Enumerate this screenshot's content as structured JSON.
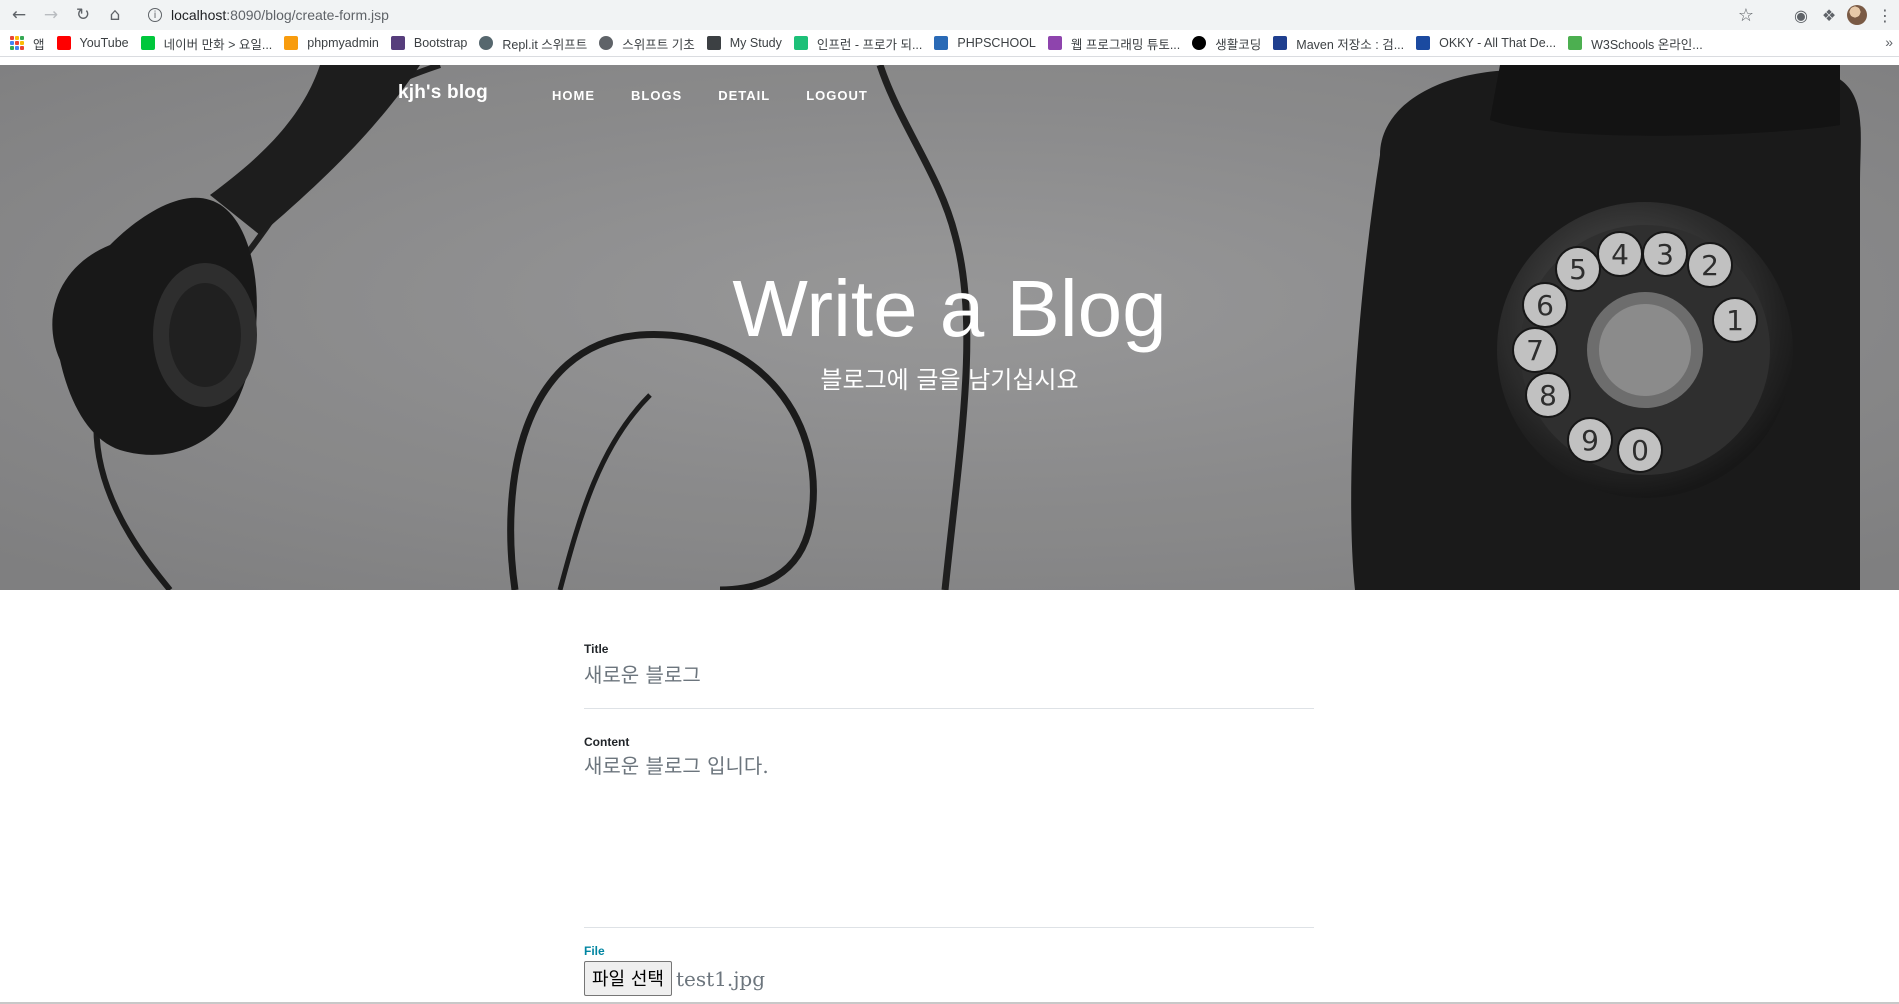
{
  "browser": {
    "url_host": "localhost",
    "url_path": ":8090/blog/create-form.jsp",
    "bookmarks": [
      {
        "label": "앱",
        "icon": "apps-grid-icon"
      },
      {
        "label": "YouTube",
        "icon": "youtube-icon",
        "color": "#ff0000"
      },
      {
        "label": "네이버 만화 > 요일...",
        "icon": "naver-webtoon-icon",
        "color": "#00c73c"
      },
      {
        "label": "phpmyadmin",
        "icon": "phpmyadmin-icon",
        "color": "#f89c0e"
      },
      {
        "label": "Bootstrap",
        "icon": "bootstrap-icon",
        "color": "#563d7c"
      },
      {
        "label": "Repl.it 스위프트",
        "icon": "replit-icon",
        "color": "#56676e"
      },
      {
        "label": "스위프트 기초",
        "icon": "globe-icon",
        "color": "#5f6368"
      },
      {
        "label": "My Study",
        "icon": "mystudy-icon",
        "color": "#3c4043"
      },
      {
        "label": "인프런 - 프로가 되...",
        "icon": "inflearn-icon",
        "color": "#1dc078"
      },
      {
        "label": "PHPSCHOOL",
        "icon": "phpschool-icon",
        "color": "#2a6ab6"
      },
      {
        "label": "웹 프로그래밍 튜토...",
        "icon": "webprog-icon",
        "color": "#8e44ad"
      },
      {
        "label": "생활코딩",
        "icon": "opentutorials-icon",
        "color": "#000000"
      },
      {
        "label": "Maven 저장소 : 검...",
        "icon": "maven-icon",
        "color": "#1f3f8f"
      },
      {
        "label": "OKKY - All That De...",
        "icon": "okky-icon",
        "color": "#1b4aa0"
      },
      {
        "label": "W3Schools 온라인...",
        "icon": "w3schools-icon",
        "color": "#4caf50"
      }
    ]
  },
  "nav": {
    "brand": "kjh's blog",
    "links": [
      "HOME",
      "BLOGS",
      "DETAIL",
      "LOGOUT"
    ]
  },
  "hero": {
    "title": "Write a Blog",
    "subtitle": "블로그에 글을 남기십시요"
  },
  "form": {
    "title_label": "Title",
    "title_value": "새로운 블로그",
    "content_label": "Content",
    "content_value": "새로운 블로그 입니다.",
    "file_label": "File",
    "file_button": "파일 선택",
    "file_name": "test1.jpg"
  },
  "colors": {
    "accent": "#0085a1",
    "hero_gray": "#8b8b8c"
  }
}
